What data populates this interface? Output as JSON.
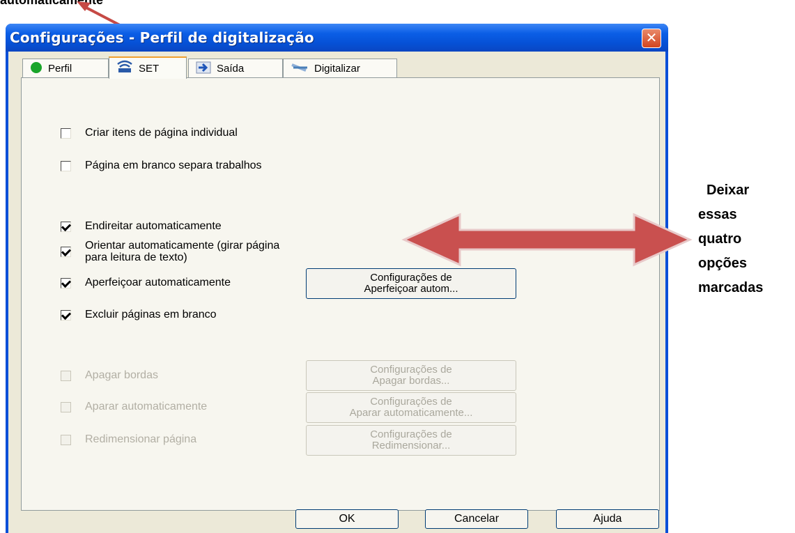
{
  "top_caption": "automaticamente",
  "window": {
    "title": "Configurações - Perfil de digitalização",
    "close": "✕"
  },
  "tabs": [
    {
      "label": "Perfil",
      "icon": "green-circle-icon",
      "active": false
    },
    {
      "label": "SET",
      "icon": "scanner-set-icon",
      "active": true
    },
    {
      "label": "Saída",
      "icon": "arrow-output-icon",
      "active": false
    },
    {
      "label": "Digitalizar",
      "icon": "scan-icon",
      "active": false
    }
  ],
  "options": {
    "criar_itens": {
      "label": "Criar itens de página individual",
      "checked": false,
      "enabled": true
    },
    "pagina_branco_separa": {
      "label": "Página em branco separa trabalhos",
      "checked": false,
      "enabled": true
    },
    "endireitar": {
      "label": "Endireitar automaticamente",
      "checked": true,
      "enabled": true
    },
    "orientar": {
      "label_line1": "Orientar automaticamente (girar página",
      "label_line2": "para leitura de texto)",
      "checked": true,
      "enabled": true
    },
    "aperfeicoar": {
      "label": "Aperfeiçoar automaticamente",
      "checked": true,
      "enabled": true
    },
    "excluir_branco": {
      "label": "Excluir páginas em branco",
      "checked": true,
      "enabled": true
    },
    "apagar_bordas": {
      "label": "Apagar bordas",
      "checked": false,
      "enabled": false
    },
    "aparar": {
      "label": "Aparar automaticamente",
      "checked": false,
      "enabled": false
    },
    "redimensionar": {
      "label": "Redimensionar página",
      "checked": false,
      "enabled": false
    }
  },
  "settings_buttons": {
    "aperfeicoar": {
      "line1": "Configurações de",
      "line2": "Aperfeiçoar autom..."
    },
    "apagar": {
      "line1": "Configurações de",
      "line2": "Apagar bordas..."
    },
    "aparar": {
      "line1": "Configurações de",
      "line2": "Aparar automaticamente..."
    },
    "redimensionar": {
      "line1": "Configurações de",
      "line2": "Redimensionar..."
    }
  },
  "footer": {
    "ok": "OK",
    "cancel": "Cancelar",
    "help": "Ajuda"
  },
  "annotation": {
    "lines": [
      "Deixar",
      "essas",
      "quatro",
      "opções",
      "marcadas"
    ],
    "arrow_color": "#c9504f"
  },
  "colors": {
    "titlebar": "#0651d6",
    "dialog_bg": "#ece9d8",
    "close_button": "#d1441f"
  }
}
